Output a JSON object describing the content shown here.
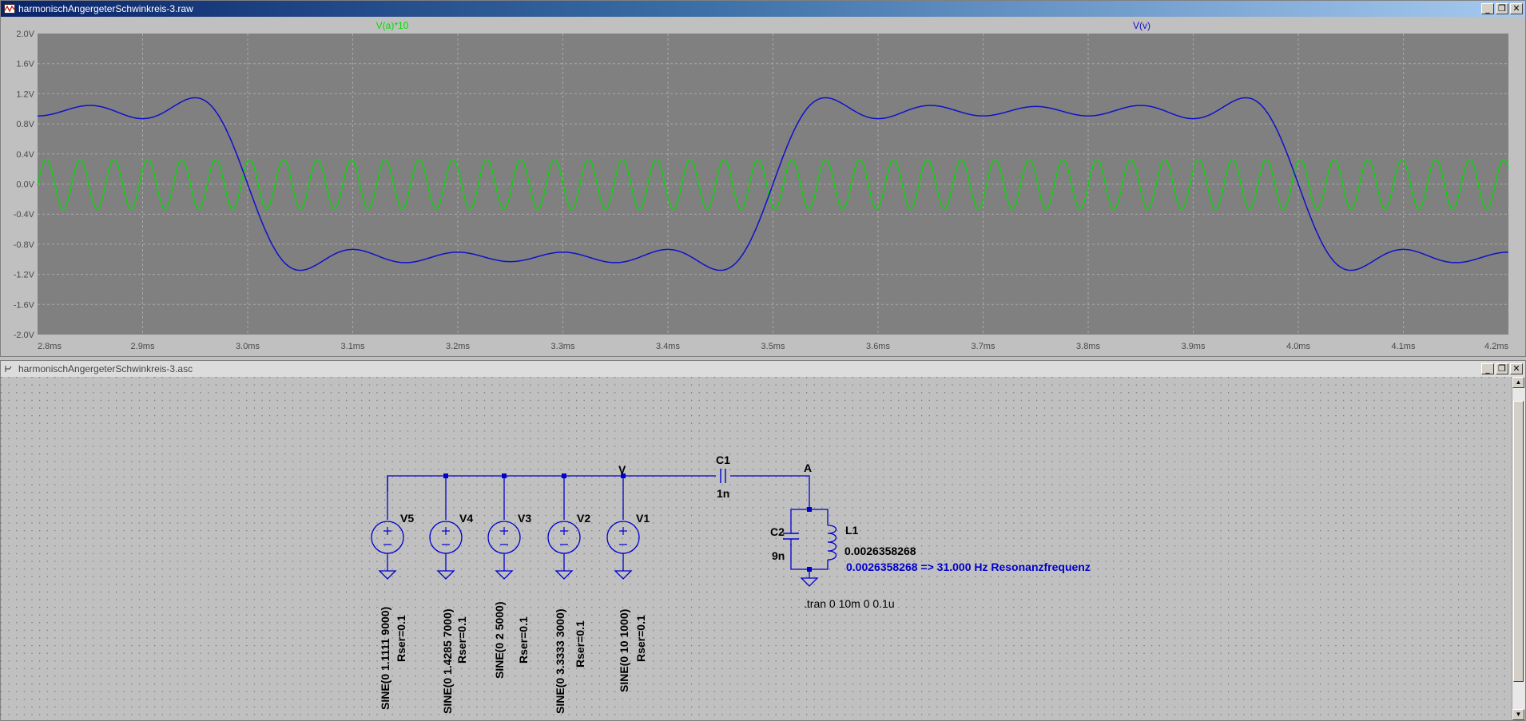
{
  "plot_window": {
    "title": "harmonischAngergeterSchwinkreis-3.raw",
    "traces": [
      {
        "label": "V(a)*10",
        "color": "#00dd00"
      },
      {
        "label": "V(v)",
        "color": "#1010cc"
      }
    ],
    "y_ticks": [
      "2.0V",
      "1.6V",
      "1.2V",
      "0.8V",
      "0.4V",
      "0.0V",
      "-0.4V",
      "-0.8V",
      "-1.2V",
      "-1.6V",
      "-2.0V"
    ],
    "x_ticks": [
      "2.8ms",
      "2.9ms",
      "3.0ms",
      "3.1ms",
      "3.2ms",
      "3.3ms",
      "3.4ms",
      "3.5ms",
      "3.6ms",
      "3.7ms",
      "3.8ms",
      "3.9ms",
      "4.0ms",
      "4.1ms",
      "4.2ms"
    ]
  },
  "schematic_window": {
    "title": "harmonischAngergeterSchwinkreis-3.asc",
    "sources": [
      {
        "ref": "V5",
        "value": "SINE(0 1.1111 9000)",
        "rser": "Rser=0.1"
      },
      {
        "ref": "V4",
        "value": "SINE(0 1.4285 7000)",
        "rser": "Rser=0.1"
      },
      {
        "ref": "V3",
        "value": "SINE(0 2 5000)",
        "rser": "Rser=0.1"
      },
      {
        "ref": "V2",
        "value": "SINE(0 3.3333 3000)",
        "rser": "Rser=0.1"
      },
      {
        "ref": "V1",
        "value": "SINE(0 10 1000)",
        "rser": "Rser=0.1"
      }
    ],
    "net_v": "V",
    "net_a": "A",
    "c1": {
      "ref": "C1",
      "value": "1n"
    },
    "c2": {
      "ref": "C2",
      "value": "9n"
    },
    "l1": {
      "ref": "L1",
      "value": "0.0026358268"
    },
    "comment": "0.0026358268 => 31.000 Hz Resonanzfrequenz",
    "directive": ".tran 0 10m 0 0.1u"
  },
  "colors": {
    "plot_bg": "#808080",
    "grid": "#a8a8a8",
    "wire": "#0000cc",
    "schematic_bg": "#c0c0c0"
  }
}
